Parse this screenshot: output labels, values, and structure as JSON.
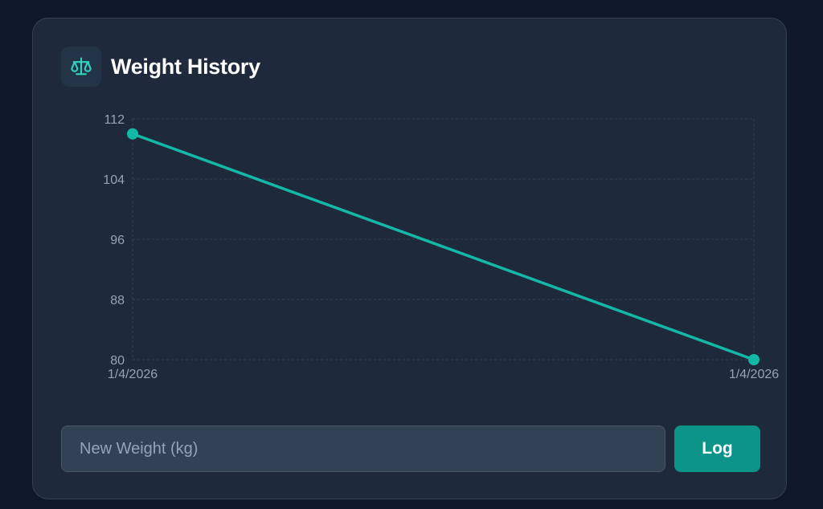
{
  "header": {
    "title": "Weight History",
    "icon": "scale-icon"
  },
  "colors": {
    "accent": "#14b8a6",
    "button": "#0d9488",
    "grid": "#334155",
    "tick": "#94a3b8"
  },
  "chart_data": {
    "type": "line",
    "title": "",
    "xlabel": "",
    "ylabel": "",
    "x": [
      "1/4/2026",
      "1/4/2026"
    ],
    "series": [
      {
        "values": [
          110,
          80
        ]
      }
    ],
    "ylim": [
      80,
      112
    ],
    "yticks": [
      "112",
      "104",
      "96",
      "88",
      "80"
    ],
    "grid": true
  },
  "form": {
    "placeholder": "New Weight (kg)",
    "value": "",
    "button_label": "Log"
  }
}
